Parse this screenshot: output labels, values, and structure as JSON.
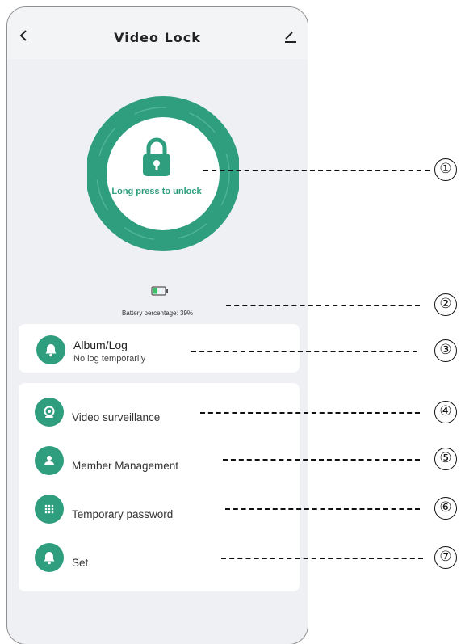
{
  "header": {
    "title": "Video Lock"
  },
  "lock": {
    "label": "Long press to unlock"
  },
  "battery": {
    "text": "Battery percentage: 39%",
    "percent": 39
  },
  "album": {
    "title": "Album/Log",
    "subtitle": "No log temporarily"
  },
  "menu": {
    "items": [
      {
        "label": "Video surveillance",
        "icon": "camera-icon"
      },
      {
        "label": "Member Management",
        "icon": "person-icon"
      },
      {
        "label": "Temporary password",
        "icon": "keypad-icon"
      },
      {
        "label": "Set",
        "icon": "bell-icon"
      }
    ]
  },
  "callouts": [
    "①",
    "②",
    "③",
    "④",
    "⑤",
    "⑥",
    "⑦"
  ],
  "colors": {
    "accent": "#2f9e7e",
    "background": "#eef0f3",
    "card": "#ffffff"
  }
}
